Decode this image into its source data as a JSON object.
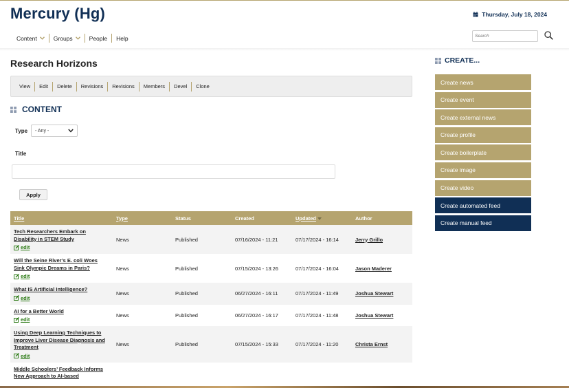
{
  "site": {
    "title": "Mercury (Hg)",
    "date": "Thursday, July 18, 2024"
  },
  "nav": {
    "items": [
      {
        "label": "Content",
        "has_dropdown": true
      },
      {
        "label": "Groups",
        "has_dropdown": true
      },
      {
        "label": "People",
        "has_dropdown": false
      },
      {
        "label": "Help",
        "has_dropdown": false
      }
    ]
  },
  "search": {
    "placeholder": "Search",
    "icon": "search-icon"
  },
  "page": {
    "title": "Research Horizons"
  },
  "tabs": [
    "View",
    "Edit",
    "Delete",
    "Revisions",
    "Revisions",
    "Members",
    "Devel",
    "Clone"
  ],
  "content_section": {
    "heading": "CONTENT",
    "filters": {
      "type_label": "Type",
      "type_value": "- Any -",
      "title_label": "Title",
      "title_value": "",
      "apply_label": "Apply"
    }
  },
  "table": {
    "headers": {
      "title": "Title",
      "type": "Type",
      "status": "Status",
      "created": "Created",
      "updated": "Updated",
      "author": "Author"
    },
    "edit_label": "edit",
    "rows": [
      {
        "title": "Tech Researchers Embark on Disability in STEM Study",
        "type": "News",
        "status": "Published",
        "created": "07/16/2024 - 11:21",
        "updated": "07/17/2024 - 16:14",
        "author": "Jerry Grillo"
      },
      {
        "title": "Will the Seine River’s E. coli Woes Sink Olympic Dreams in Paris?",
        "type": "News",
        "status": "Published",
        "created": "07/15/2024 - 13:26",
        "updated": "07/17/2024 - 16:04",
        "author": "Jason Maderer"
      },
      {
        "title": "What IS Artificial Intelligence?",
        "type": "News",
        "status": "Published",
        "created": "06/27/2024 - 16:11",
        "updated": "07/17/2024 - 11:49",
        "author": "Joshua Stewart"
      },
      {
        "title": "AI for a Better World",
        "type": "News",
        "status": "Published",
        "created": "06/27/2024 - 16:17",
        "updated": "07/17/2024 - 11:48",
        "author": "Joshua Stewart"
      },
      {
        "title": "Using Deep Learning Techniques to Improve Liver Disease Diagnosis and Treatment",
        "type": "News",
        "status": "Published",
        "created": "07/15/2024 - 15:33",
        "updated": "07/17/2024 - 11:20",
        "author": "Christa Ernst"
      },
      {
        "title": "Middle Schoolers’ Feedback Informs New Approach to AI-based",
        "type": "",
        "status": "",
        "created": "",
        "updated": "",
        "author": ""
      }
    ]
  },
  "create": {
    "heading": "CREATE...",
    "buttons": [
      {
        "label": "Create news",
        "style": "gold"
      },
      {
        "label": "Create event",
        "style": "gold"
      },
      {
        "label": "Create external news",
        "style": "gold"
      },
      {
        "label": "Create profile",
        "style": "gold"
      },
      {
        "label": "Create boilerplate",
        "style": "gold"
      },
      {
        "label": "Create image",
        "style": "gold"
      },
      {
        "label": "Create video",
        "style": "gold"
      },
      {
        "label": "Create automated feed",
        "style": "navy"
      },
      {
        "label": "Create manual feed",
        "style": "navy"
      }
    ]
  },
  "colors": {
    "navy": "#102f55",
    "gold": "#b5a46f",
    "edit_green": "#2b7a14"
  }
}
